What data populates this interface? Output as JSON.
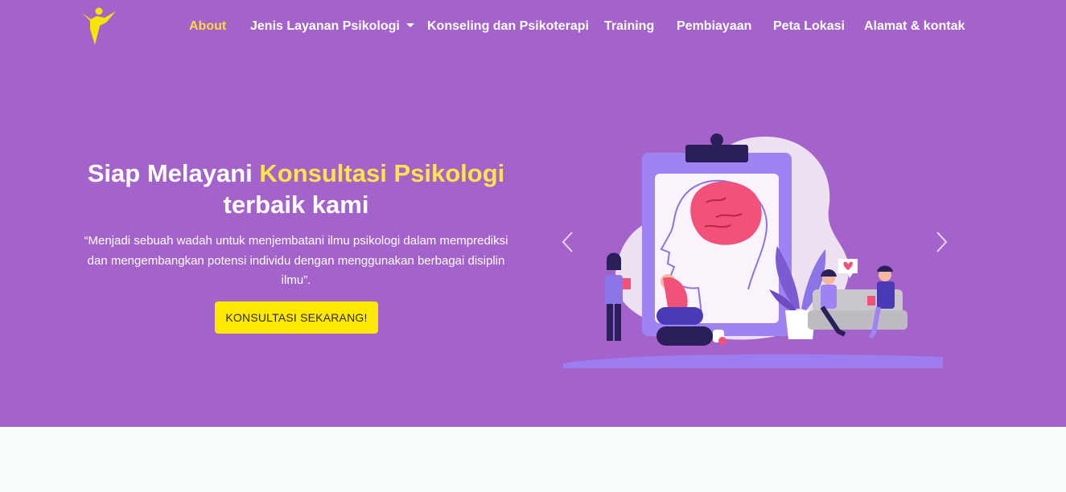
{
  "nav": {
    "items": [
      {
        "label": "About",
        "active": true
      },
      {
        "label": "Jenis Layanan Psikologi",
        "dropdown": true
      },
      {
        "label": "Konseling dan Psikoterapi"
      },
      {
        "label": "Training"
      },
      {
        "label": "Pembiayaan"
      },
      {
        "label": "Peta Lokasi"
      },
      {
        "label": "Alamat & kontak"
      }
    ]
  },
  "hero": {
    "title_part1": "Siap Melayani ",
    "title_highlight": "Konsultasi Psikologi",
    "title_part2": "terbaik kami",
    "quote": "“Menjadi sebuah wadah untuk menjembatani ilmu psikologi dalam memprediksi dan mengembangkan potensi individu dengan menggunakan berbagai disiplin ilmu”.",
    "cta_label": "KONSULTASI SEKARANG!"
  },
  "colors": {
    "hero_background": "#a462cb",
    "accent_yellow": "#ffe34d",
    "button_yellow": "#ffe900",
    "active_nav": "#ffd93b",
    "page_background": "#f8fcfd"
  },
  "icons": {
    "logo": "person-star-logo-icon",
    "prev": "chevron-left-icon",
    "next": "chevron-right-icon",
    "dropdown": "caret-down-icon"
  }
}
